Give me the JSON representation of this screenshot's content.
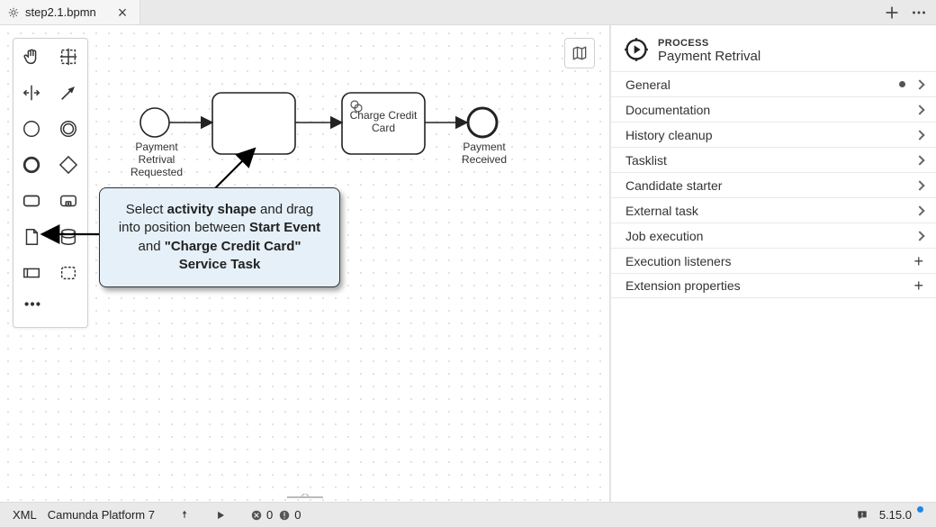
{
  "tab": {
    "filename": "step2.1.bpmn"
  },
  "process": {
    "type_label": "PROCESS",
    "name": "Payment Retrival"
  },
  "sections": [
    {
      "label": "General",
      "dot": true,
      "action": "chev"
    },
    {
      "label": "Documentation",
      "dot": false,
      "action": "chev"
    },
    {
      "label": "History cleanup",
      "dot": false,
      "action": "chev"
    },
    {
      "label": "Tasklist",
      "dot": false,
      "action": "chev"
    },
    {
      "label": "Candidate starter",
      "dot": false,
      "action": "chev"
    },
    {
      "label": "External task",
      "dot": false,
      "action": "chev"
    },
    {
      "label": "Job execution",
      "dot": false,
      "action": "chev"
    },
    {
      "label": "Execution listeners",
      "dot": false,
      "action": "plus"
    },
    {
      "label": "Extension properties",
      "dot": false,
      "action": "plus"
    }
  ],
  "diagram": {
    "start_label": "Payment Retrival\nRequested",
    "task_label": "Charge Credit\nCard",
    "end_label": "Payment\nReceived"
  },
  "callout": {
    "pre": "Select ",
    "b1": "activity shape",
    "mid1": " and drag into position between ",
    "b2": "Start Event",
    "mid2": " and ",
    "b3": "\"Charge Credit Card\" Service Task"
  },
  "status": {
    "xml": "XML",
    "platform": "Camunda Platform 7",
    "errors": "0",
    "warnings": "0",
    "version": "5.15.0"
  }
}
